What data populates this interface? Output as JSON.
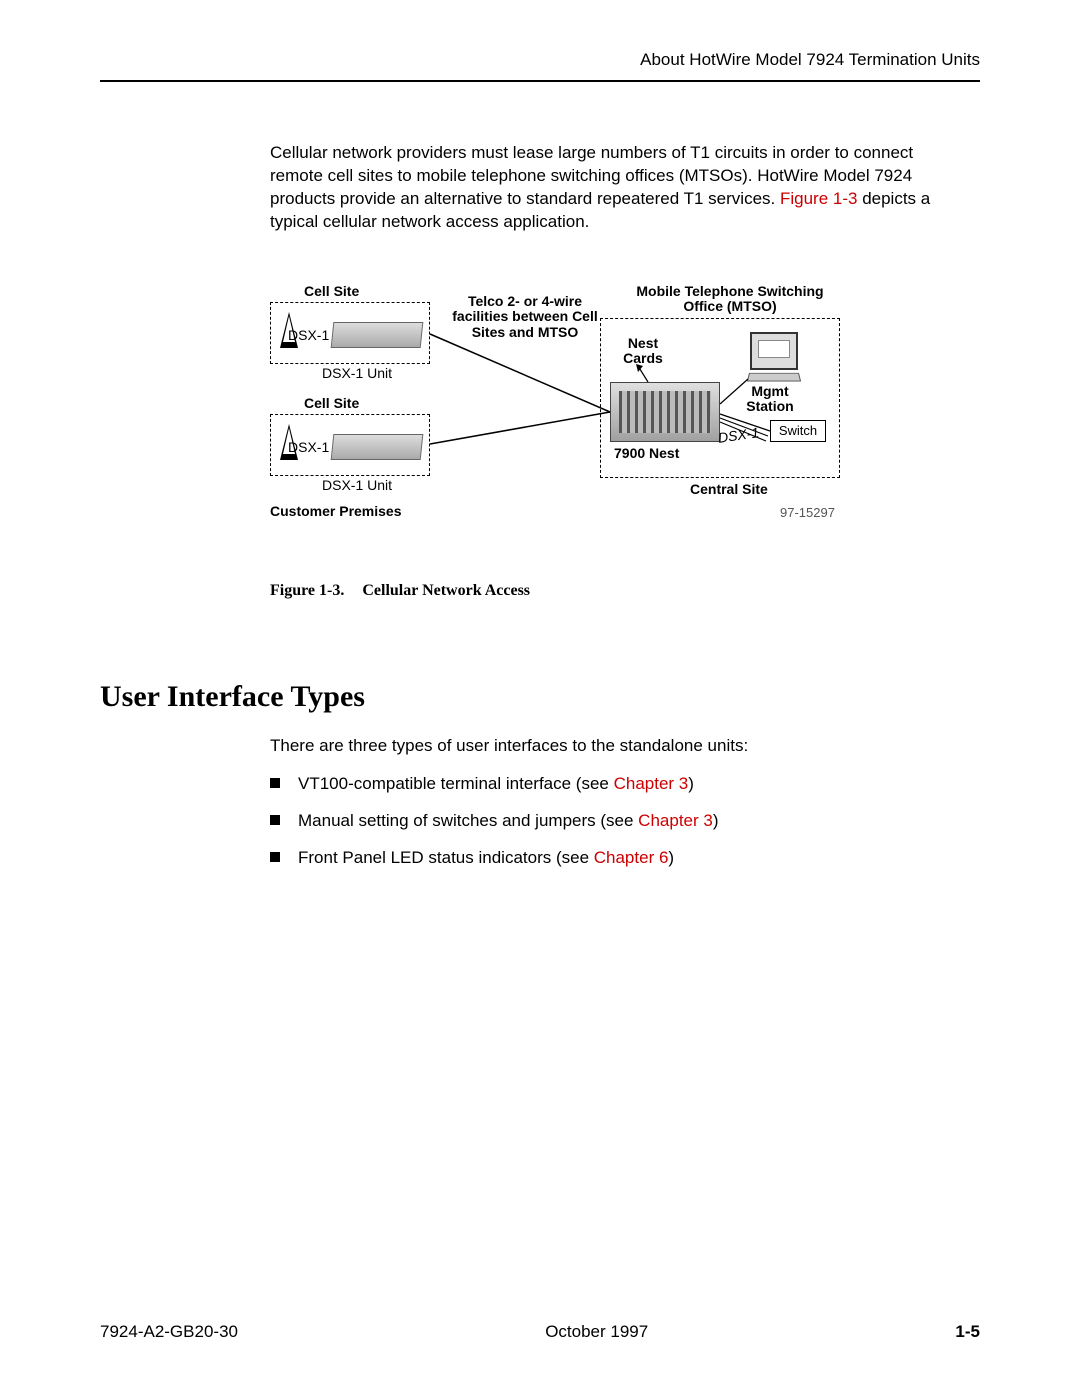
{
  "header": {
    "title": "About HotWire Model 7924 Termination Units"
  },
  "paragraph": {
    "pre": "Cellular network providers must lease large numbers of T1 circuits in order to connect remote cell sites to mobile telephone switching offices (MTSOs). HotWire Model 7924 products provide an alternative to standard repeatered T1 services. ",
    "link": "Figure 1-3",
    "post": " depicts a typical cellular network access application."
  },
  "figure": {
    "labels": {
      "cell_site": "Cell Site",
      "dsx1": "DSX-1",
      "dsx1_unit": "DSX-1 Unit",
      "telco": "Telco  2- or 4-wire facilities between Cell Sites and MTSO",
      "mtso": "Mobile Telephone Switching Office (MTSO)",
      "nest_cards": "Nest Cards",
      "mgmt": "Mgmt Station",
      "switch": "Switch",
      "dsx1_link": "DSX-1",
      "nest7900": "7900 Nest",
      "central": "Central Site",
      "cust": "Customer Premises",
      "num": "97-15297"
    },
    "caption_num": "Figure 1-3.",
    "caption_title": "Cellular Network Access"
  },
  "section": {
    "heading": "User Interface Types",
    "intro": "There are three types of user interfaces to the standalone units:",
    "items": [
      {
        "text": "VT100-compatible terminal interface (see ",
        "link": "Chapter 3",
        "after": ")"
      },
      {
        "text": "Manual setting of switches and jumpers (see ",
        "link": "Chapter 3",
        "after": ")"
      },
      {
        "text": "Front Panel LED status indicators (see ",
        "link": "Chapter 6",
        "after": ")"
      }
    ]
  },
  "footer": {
    "docnum": "7924-A2-GB20-30",
    "date": "October 1997",
    "page": "1-5"
  }
}
